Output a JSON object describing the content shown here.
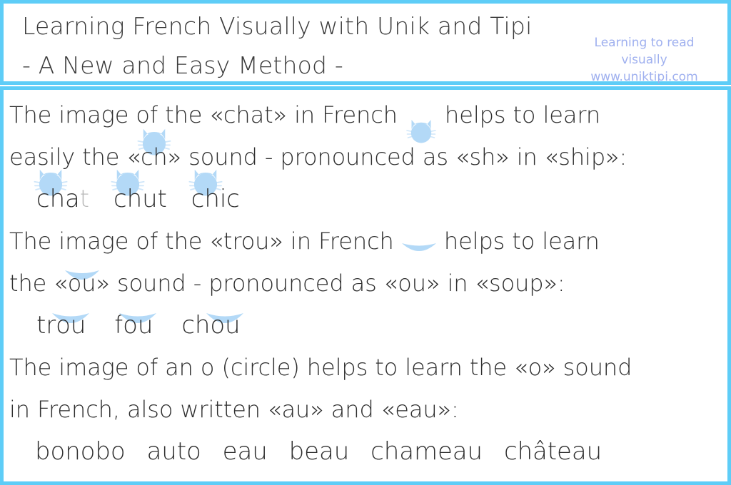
{
  "header": {
    "title_line1": "Learning French Visually with Unik and Tipi",
    "title_line2": "- A New and Easy Method -",
    "brand_line1": "Learning to read",
    "brand_line2": "visually",
    "brand_line3": "www.uniktipi.com"
  },
  "colors": {
    "border": "#5ecdf7",
    "highlight": "#b3d9f7",
    "text": "#2f2f2f",
    "brand": "#9fb0ef",
    "muted_letter": "#b9b9b9"
  },
  "lessons": [
    {
      "id": "ch-sound",
      "icon": "cat-icon",
      "sentence": {
        "part1": "The image of the «chat» in French ",
        "part2": " helps to learn",
        "line2_a": "easily the «",
        "line2_highlight": "ch",
        "line2_b": "» sound - pronounced as «sh» in «ship»:"
      },
      "examples": [
        {
          "highlight": "ch",
          "rest": "at",
          "muted_tail": "t",
          "visible_rest": "a"
        },
        {
          "highlight": "ch",
          "rest": "ut"
        },
        {
          "highlight": "ch",
          "rest": "ic"
        }
      ]
    },
    {
      "id": "ou-sound",
      "icon": "hole-icon",
      "sentence": {
        "part1": "The image of the «trou» in French ",
        "part2": " helps to learn",
        "line2_a": "the «",
        "line2_highlight": "ou",
        "line2_b": "» sound - pronounced as «ou» in «soup»:"
      },
      "examples": [
        {
          "prefix": "tr",
          "highlight": "ou"
        },
        {
          "prefix": "f",
          "highlight": "ou"
        },
        {
          "prefix": "ch",
          "highlight": "ou"
        }
      ]
    },
    {
      "id": "o-au-eau-sound",
      "icon": "circle-icon",
      "sentence": {
        "line1_a": "The image of an o (circle) helps to learn the «",
        "line1_highlight": "o",
        "line1_b": "» sound",
        "line2_a": "in French, also written «",
        "line2_highlight1": "au",
        "line2_mid": "» and «",
        "line2_highlight2": "eau",
        "line2_b": "»:"
      },
      "examples": [
        {
          "word": "bonobo",
          "pattern": "b[o]n[o]b[o]"
        },
        {
          "word": "auto",
          "pattern": "[au]t[o]"
        },
        {
          "word": "eau",
          "pattern": "[eau]"
        },
        {
          "word": "beau",
          "pattern": "b[eau]"
        },
        {
          "word": "chameau",
          "pattern": "cham[eau]"
        },
        {
          "word": "château",
          "pattern": "chât[eau]"
        }
      ]
    }
  ],
  "words": {
    "chat_ch": "ch",
    "chat_a": "a",
    "chat_t": "t",
    "chut_ch": "ch",
    "chut_ut": "ut",
    "chic_ch": "ch",
    "chic_ic": "ic",
    "trou_tr": "tr",
    "trou_ou": "ou",
    "fou_f": "f",
    "fou_ou": "ou",
    "chou_ch": "ch",
    "chou_ou": "ou",
    "bonobo_b1": "b",
    "bonobo_o1": "o",
    "bonobo_n": "n",
    "bonobo_o2": "o",
    "bonobo_b2": "b",
    "bonobo_o3": "o",
    "auto_au": "au",
    "auto_t": "t",
    "auto_o": "o",
    "eau": "eau",
    "beau_b": "b",
    "beau_eau": "eau",
    "chameau_cham": "cham",
    "chameau_eau": "eau",
    "chateau_chat": "chât",
    "chateau_eau": "eau"
  }
}
